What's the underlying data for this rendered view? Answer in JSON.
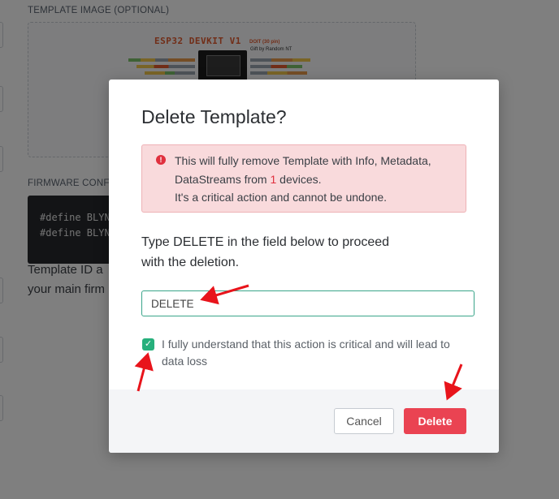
{
  "background": {
    "template_image_label": "TEMPLATE IMAGE (OPTIONAL)",
    "board_title": "ESP32 DEVKIT V1",
    "board_sub_title": "DOIT",
    "board_sub_note": "(30 pin)",
    "board_credit": "Gift by Random NT",
    "firmware_label": "FIRMWARE CONFI",
    "code_lines": [
      "#define BLYN",
      "#define BLYN"
    ],
    "description_lines": [
      "Template ID a",
      "your main firm"
    ]
  },
  "modal": {
    "title": "Delete Template?",
    "alert": {
      "icon": "!",
      "line1": "This will fully remove Template with Info, Metadata,",
      "line2_prefix": "DataStreams from ",
      "device_count": "1",
      "line2_suffix": " devices.",
      "line3": "It's a critical action and cannot be undone."
    },
    "prompt_line1": "Type DELETE in the field below to proceed",
    "prompt_line2": "with the deletion.",
    "confirm_input_value": "DELETE",
    "checkbox_checked": true,
    "checkbox_mark": "✓",
    "checkbox_label": "I fully understand that this action is critical and will lead to data loss",
    "cancel_label": "Cancel",
    "delete_label": "Delete"
  },
  "colors": {
    "accent_green": "#27b07c",
    "danger_red": "#ea4352",
    "annotation_arrow": "#e8141b"
  }
}
